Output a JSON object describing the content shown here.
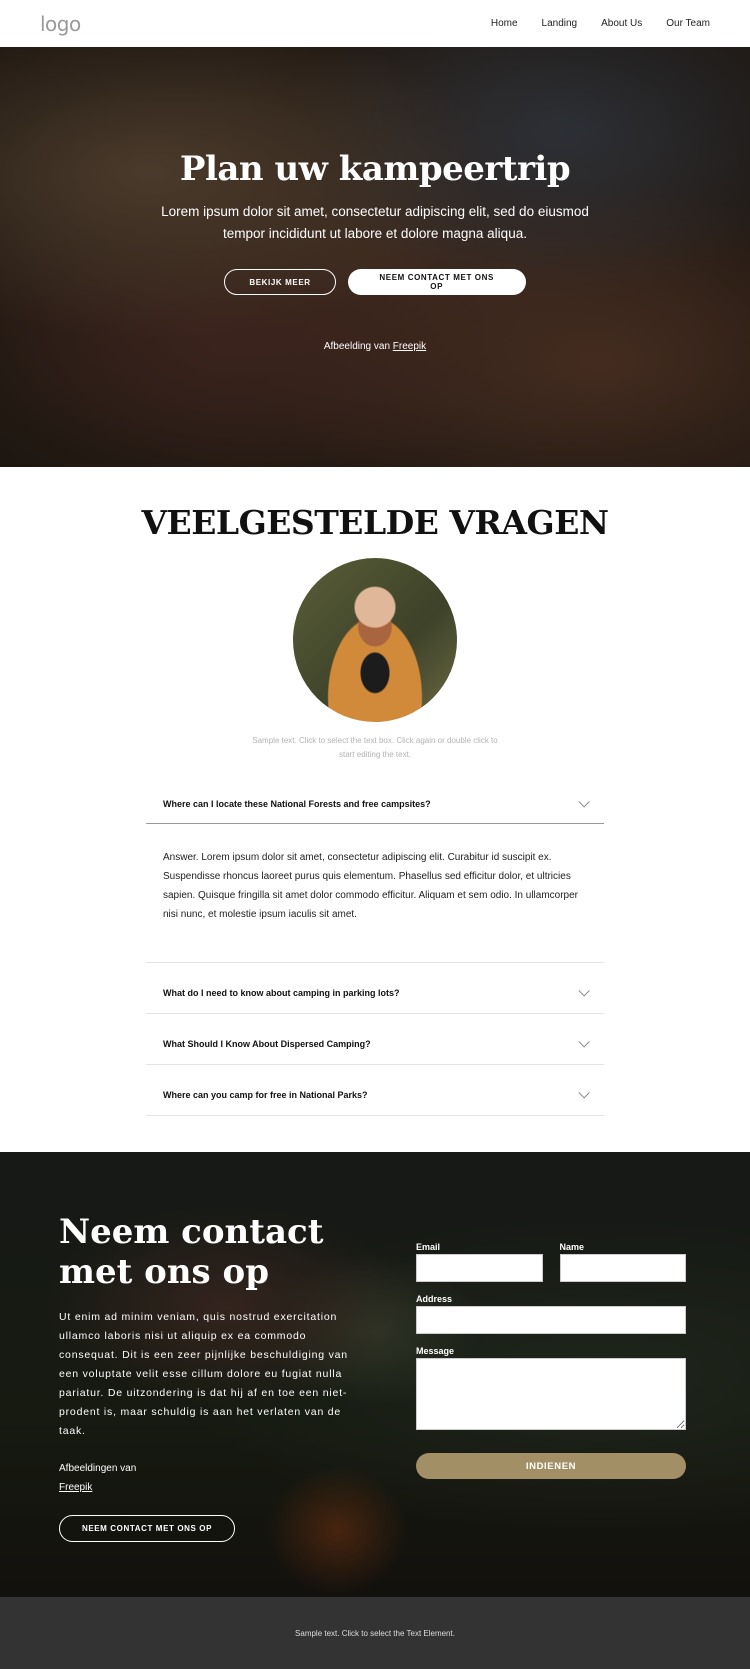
{
  "header": {
    "logo": "logo",
    "nav": [
      "Home",
      "Landing",
      "About Us",
      "Our Team"
    ]
  },
  "hero": {
    "title": "Plan uw kampeertrip",
    "subtitle": "Lorem ipsum dolor sit amet, consectetur adipiscing elit, sed do eiusmod tempor incididunt ut labore et dolore magna aliqua.",
    "btn_more": "BEKIJK MEER",
    "btn_contact": "NEEM CONTACT MET ONS OP",
    "credit_prefix": "Afbeelding van ",
    "credit_link": "Freepik"
  },
  "faq": {
    "title": "VEELGESTELDE VRAGEN",
    "sample_text": "Sample text. Click to select the text box. Click again or double click to start editing the text.",
    "items": [
      {
        "question": "Where can I locate these National Forests and free campsites?",
        "answer": "Answer. Lorem ipsum dolor sit amet, consectetur adipiscing elit. Curabitur id suscipit ex. Suspendisse rhoncus laoreet purus quis elementum. Phasellus sed efficitur dolor, et ultricies sapien. Quisque fringilla sit amet dolor commodo efficitur. Aliquam et sem odio. In ullamcorper nisi nunc, et molestie ipsum iaculis sit amet.",
        "open": true
      },
      {
        "question": "What do I need to know about camping in parking lots?",
        "open": false
      },
      {
        "question": "What Should I Know About Dispersed Camping?",
        "open": false
      },
      {
        "question": "Where can you camp for free in National Parks?",
        "open": false
      }
    ]
  },
  "contact": {
    "title": "Neem contact met ons op",
    "text": "Ut enim ad minim veniam, quis nostrud exercitation ullamco laboris nisi ut aliquip ex ea commodo consequat. Dit is een zeer pijnlijke beschuldiging van een voluptate velit esse cillum dolore eu fugiat nulla pariatur. De uitzondering is dat hij af en toe een niet-prodent is, maar schuldig is aan het verlaten van de taak.",
    "credit_prefix": "Afbeeldingen van",
    "credit_link": "Freepik",
    "button": "NEEM CONTACT MET ONS OP",
    "form": {
      "email_label": "Email",
      "email_value": "",
      "name_label": "Name",
      "name_value": "",
      "address_label": "Address",
      "address_value": "",
      "message_label": "Message",
      "message_value": "",
      "submit": "INDIENEN"
    },
    "accent_color": "#a28f66"
  },
  "footer": {
    "text": "Sample text. Click to select the Text Element."
  }
}
